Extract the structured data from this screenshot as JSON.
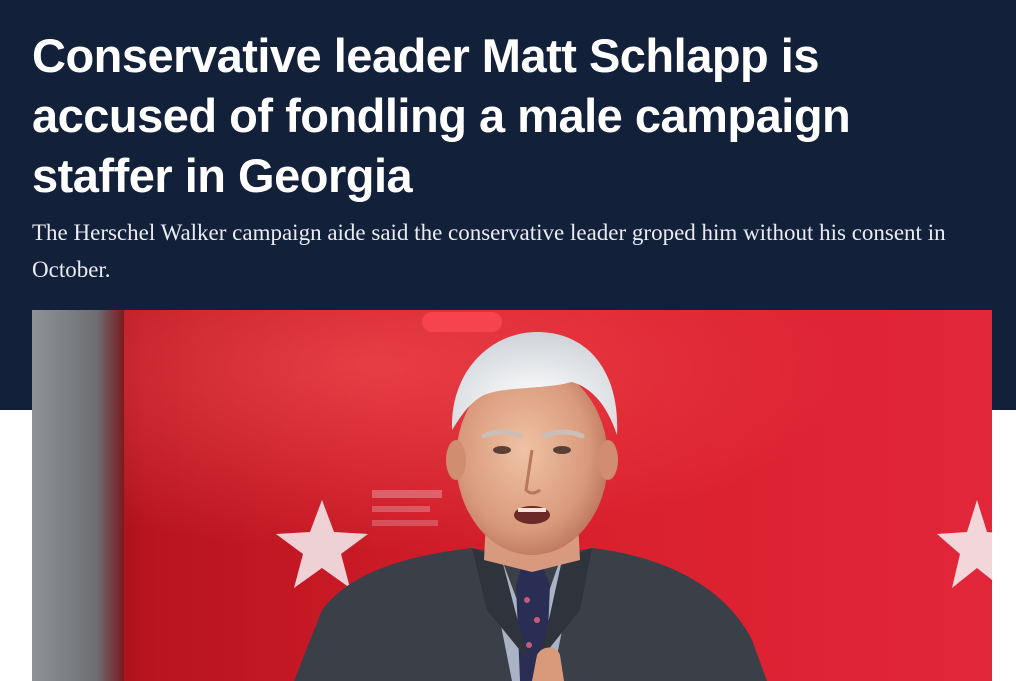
{
  "article": {
    "headline": "Conservative leader Matt Schlapp is accused of fondling a male campaign staffer in Georgia",
    "dek": "The Herschel Walker campaign aide said the conservative leader groped him without his consent in October."
  },
  "colors": {
    "header_background": "#13203a",
    "headline_text": "#ffffff",
    "dek_text": "#e9ecf2",
    "photo_backdrop_red": "#d8202c"
  },
  "photo": {
    "subject": "man with white hair in dark suit speaking on red stage with star graphics"
  }
}
